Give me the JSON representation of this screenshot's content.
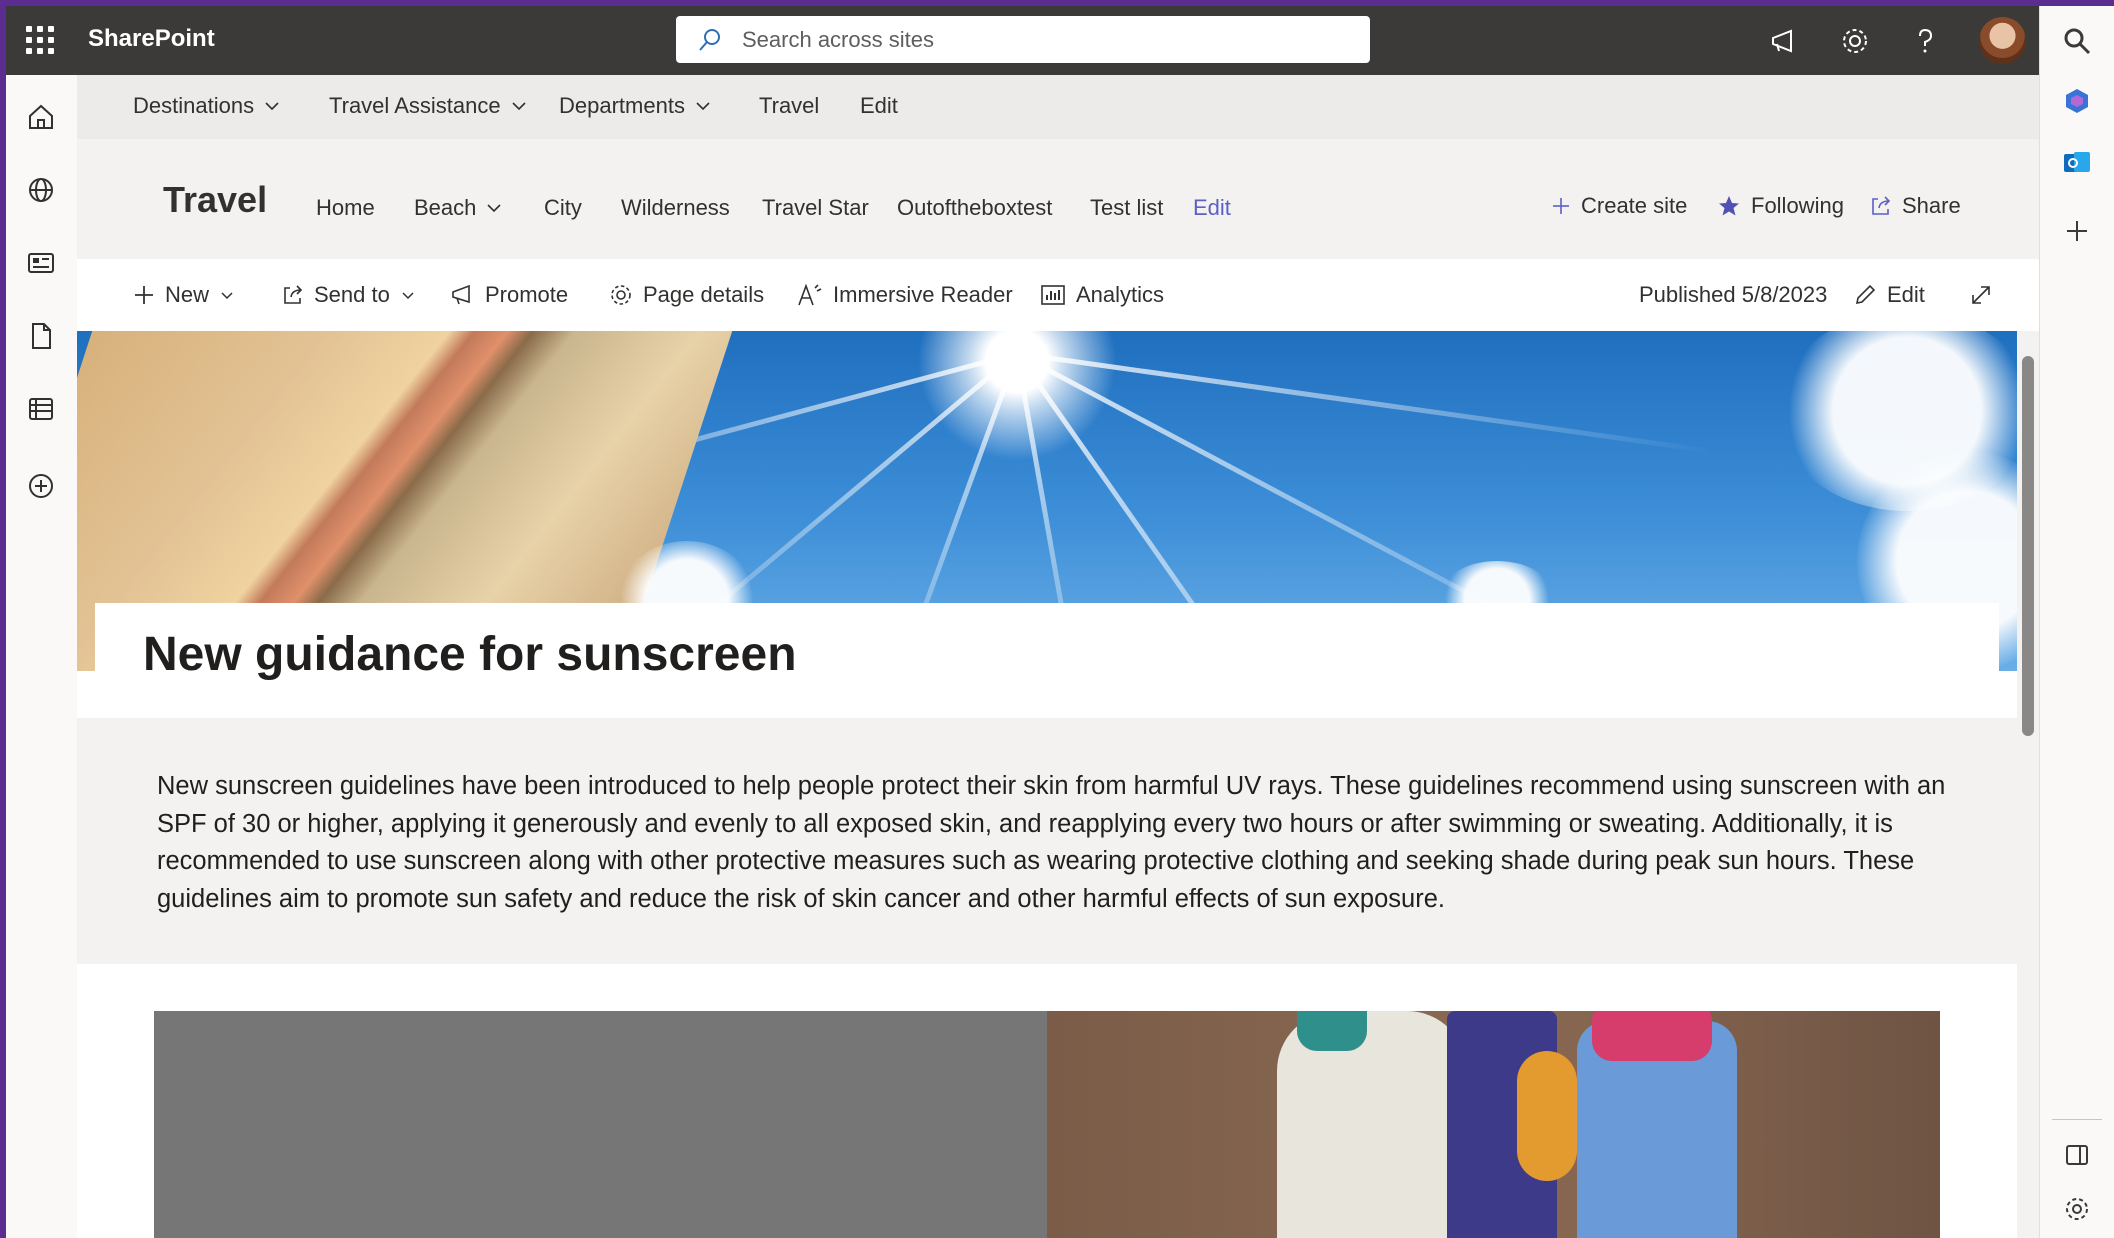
{
  "suitebar": {
    "app_name": "SharePoint",
    "search_placeholder": "Search across sites"
  },
  "hubnav": {
    "items": [
      {
        "label": "Destinations",
        "dropdown": true
      },
      {
        "label": "Travel Assistance",
        "dropdown": true
      },
      {
        "label": "Departments",
        "dropdown": true
      },
      {
        "label": "Travel",
        "dropdown": false
      },
      {
        "label": "Edit",
        "dropdown": false
      }
    ]
  },
  "site": {
    "title": "Travel",
    "nav": [
      {
        "label": "Home"
      },
      {
        "label": "Beach",
        "dropdown": true
      },
      {
        "label": "City"
      },
      {
        "label": "Wilderness"
      },
      {
        "label": "Travel Star"
      },
      {
        "label": "Outoftheboxtest"
      },
      {
        "label": "Test list"
      },
      {
        "label": "Edit"
      }
    ],
    "actions": {
      "create_site": "Create site",
      "following": "Following",
      "share": "Share"
    }
  },
  "commandbar": {
    "new": "New",
    "send_to": "Send to",
    "promote": "Promote",
    "page_details": "Page details",
    "immersive_reader": "Immersive Reader",
    "analytics": "Analytics",
    "published": "Published 5/8/2023",
    "edit": "Edit"
  },
  "page": {
    "title": "New guidance for sunscreen",
    "body": "New sunscreen guidelines have been introduced to help people protect their skin from harmful UV rays. These guidelines recommend using sunscreen with an SPF of 30 or higher, applying it generously and evenly to all exposed skin, and reapplying every two hours or after swimming or sweating. Additionally, it is recommended to use sunscreen along with other protective measures such as wearing protective clothing and seeking shade during peak sun hours. These guidelines aim to promote sun safety and reduce the risk of skin cancer and other harmful effects of sun exposure."
  },
  "colors": {
    "suitebar": "#3b3a39",
    "accent": "#5c2d91",
    "link_edit": "#5b5fc7",
    "star": "#4f52b2"
  }
}
